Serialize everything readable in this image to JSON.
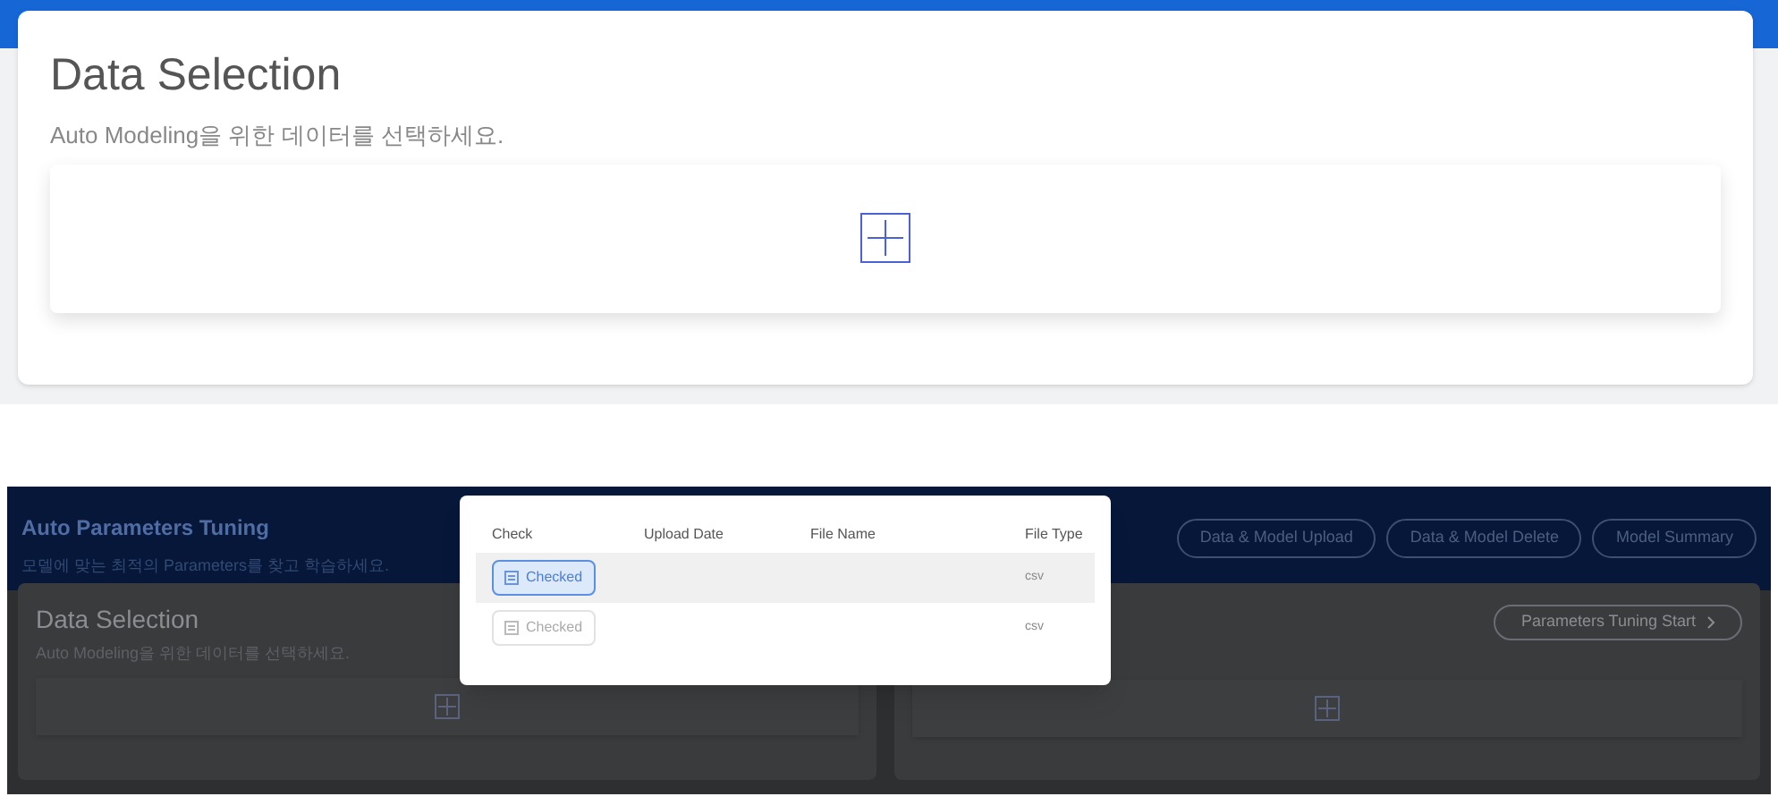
{
  "top_panel": {
    "title": "Data Selection",
    "subtitle": "Auto Modeling을 위한 데이터를 선택하세요."
  },
  "app": {
    "header": {
      "title": "Auto Parameters Tuning",
      "subtitle": "모델에 맞는 최적의 Parameters를 찾고 학습하세요.",
      "buttons": [
        "Data & Model Upload",
        "Data & Model Delete",
        "Model Summary"
      ]
    },
    "data_card": {
      "title": "Data Selection",
      "subtitle": "Auto Modeling을 위한 데이터를 선택하세요."
    },
    "tuning_card": {
      "action": "Parameters Tuning Start"
    }
  },
  "modal": {
    "columns": [
      "Check",
      "Upload Date",
      "File Name",
      "File Type"
    ],
    "rows": [
      {
        "check": "Checked",
        "selected": true,
        "file_type": "csv"
      },
      {
        "check": "Checked",
        "selected": false,
        "file_type": "csv"
      }
    ]
  }
}
